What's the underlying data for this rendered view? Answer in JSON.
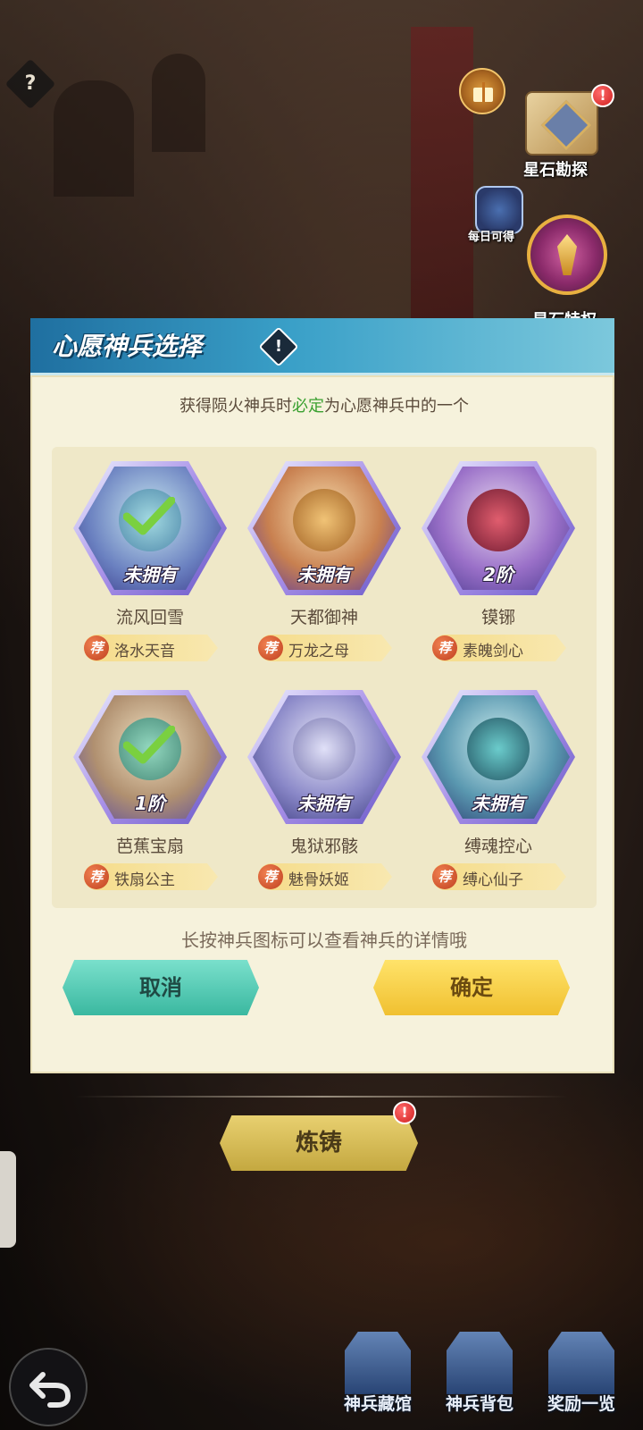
{
  "help": {
    "symbol": "?"
  },
  "side_entries": {
    "star_explore": {
      "label": "星石勘探",
      "badge": "!"
    },
    "daily": {
      "label": "每日可得"
    },
    "privilege": {
      "label": "星石特权"
    }
  },
  "modal": {
    "title": "心愿神兵选择",
    "title_info_symbol": "!",
    "subtitle_prefix": "获得陨火神兵时",
    "subtitle_highlight": "必定",
    "subtitle_suffix": "为心愿神兵中的一个",
    "rec_badge": "荐",
    "weapons": [
      {
        "name": "流风回雪",
        "status": "未拥有",
        "recommend": "洛水天音",
        "checked": true,
        "color": "#7ab8c8"
      },
      {
        "name": "天都御神",
        "status": "未拥有",
        "recommend": "万龙之母",
        "checked": false,
        "color": "#e0a860"
      },
      {
        "name": "镆铘",
        "status": "2阶",
        "recommend": "素魄剑心",
        "checked": false,
        "color": "#c04050"
      },
      {
        "name": "芭蕉宝扇",
        "status": "1阶",
        "recommend": "铁扇公主",
        "checked": true,
        "color": "#60b8a8"
      },
      {
        "name": "鬼狱邪骸",
        "status": "未拥有",
        "recommend": "魅骨妖姬",
        "checked": false,
        "color": "#b0b8e0"
      },
      {
        "name": "缚魂控心",
        "status": "未拥有",
        "recommend": "缚心仙子",
        "checked": false,
        "color": "#40a0a8"
      }
    ],
    "hint": "长按神兵图标可以查看神兵的详情哦",
    "cancel_label": "取消",
    "confirm_label": "确定"
  },
  "forge": {
    "label": "炼铸",
    "badge": "!"
  },
  "bottom_nav": [
    {
      "label": "神兵藏馆"
    },
    {
      "label": "神兵背包"
    },
    {
      "label": "奖励一览"
    }
  ],
  "colors": {
    "header_blue": "#3aa0c8",
    "panel_bg": "#f6f2dc",
    "highlight_green": "#3aa030",
    "cancel_teal": "#4cc8b0",
    "confirm_yellow": "#f5d040"
  }
}
